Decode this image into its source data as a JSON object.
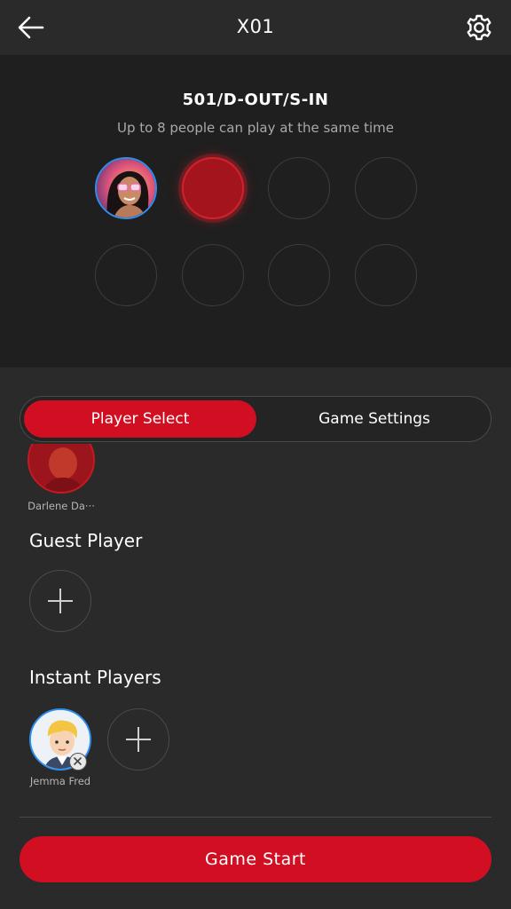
{
  "header": {
    "title": "X01",
    "back_icon": "arrow-left-icon",
    "settings_icon": "gear-icon"
  },
  "game": {
    "mode": "501/D-OUT/S-IN",
    "subtitle": "Up to 8 people can play at the same time"
  },
  "tabs": [
    {
      "label": "Player Select",
      "active": true
    },
    {
      "label": "Game Settings",
      "active": false
    }
  ],
  "players": {
    "cut_player_name": "Darlene Da···",
    "guest_title": "Guest Player",
    "instant_title": "Instant Players",
    "instant": [
      {
        "name": "Jemma Fred"
      }
    ]
  },
  "footer": {
    "start_label": "Game Start"
  },
  "colors": {
    "accent": "#d20f22",
    "selected_ring": "#2f8ff0",
    "panel_bg": "#1f1f1f",
    "page_bg": "#2a2a2a"
  }
}
